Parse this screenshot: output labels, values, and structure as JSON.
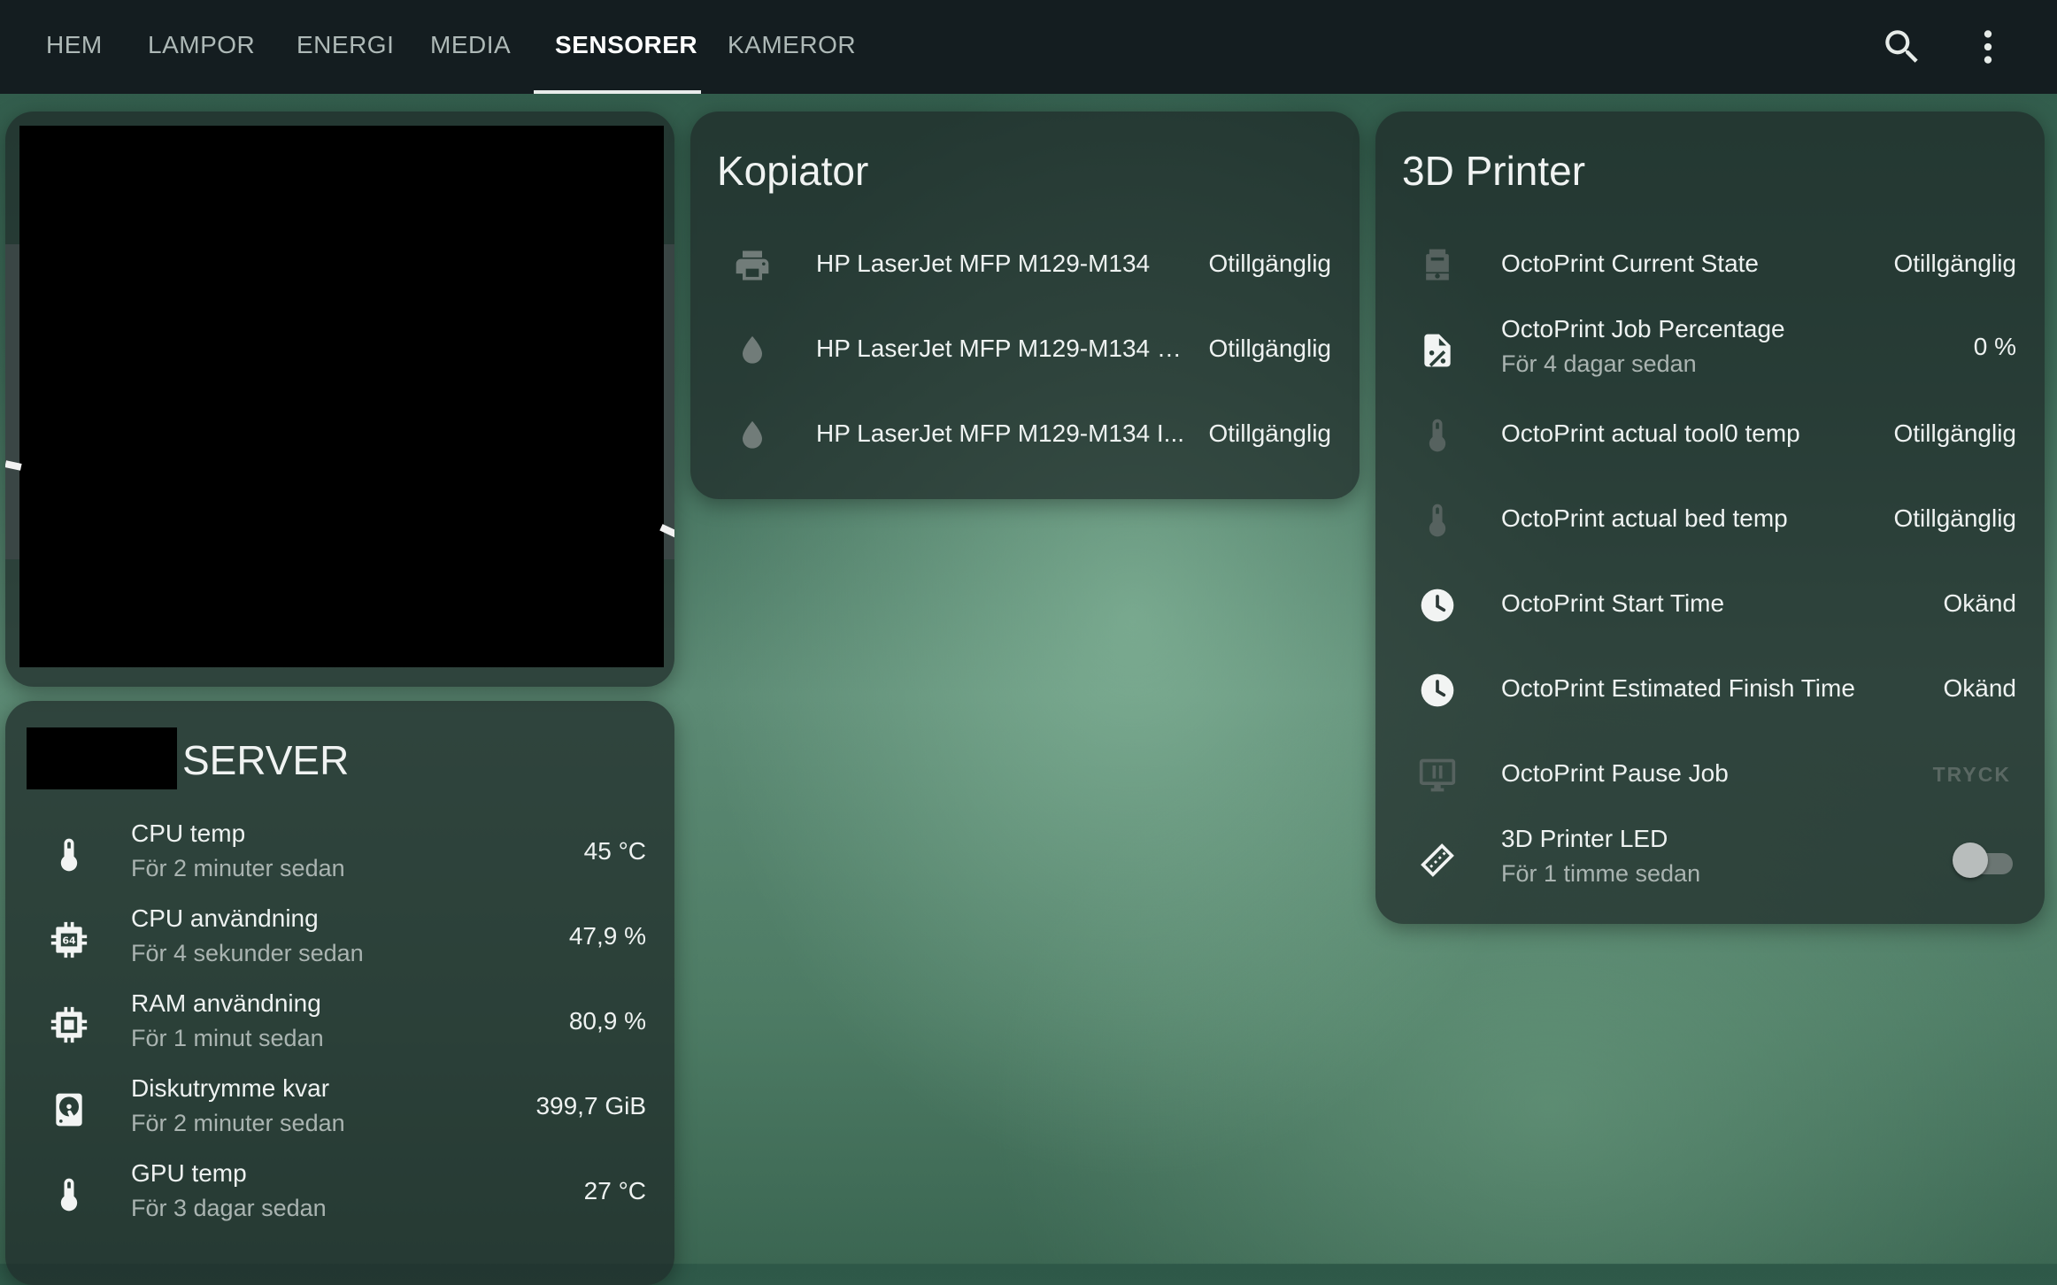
{
  "nav": {
    "tabs": [
      {
        "label": "HEM"
      },
      {
        "label": "LAMPOR"
      },
      {
        "label": "ENERGI"
      },
      {
        "label": "MEDIA"
      },
      {
        "label": "SENSORER"
      },
      {
        "label": "KAMEROR"
      }
    ],
    "active_tab": "SENSORER",
    "icons": [
      "search-icon",
      "more-vertical-icon"
    ]
  },
  "server_card": {
    "title": "SERVER",
    "rows": [
      {
        "name": "CPU temp",
        "sub": "För 2 minuter sedan",
        "value": "45 °C",
        "icon": "thermometer-icon"
      },
      {
        "name": "CPU användning",
        "sub": "För 4 sekunder sedan",
        "value": "47,9 %",
        "icon": "cpu-64-icon"
      },
      {
        "name": "RAM användning",
        "sub": "För 1 minut sedan",
        "value": "80,9 %",
        "icon": "memory-chip-icon"
      },
      {
        "name": "Diskutrymme kvar",
        "sub": "För 2 minuter sedan",
        "value": "399,7 GiB",
        "icon": "harddisk-icon"
      },
      {
        "name": "GPU temp",
        "sub": "För 3 dagar sedan",
        "value": "27 °C",
        "icon": "thermometer-icon"
      }
    ]
  },
  "copier_card": {
    "title": "Kopiator",
    "rows": [
      {
        "name": "HP LaserJet MFP M129-M134",
        "value": "Otillgänglig",
        "icon": "printer-icon"
      },
      {
        "name": "HP LaserJet MFP M129-M134 Bl...",
        "value": "Otillgänglig",
        "icon": "water-drop-icon"
      },
      {
        "name": "HP LaserJet MFP M129-M134 I...",
        "value": "Otillgänglig",
        "icon": "water-drop-icon"
      }
    ]
  },
  "printer_card": {
    "title": "3D Printer",
    "rows": [
      {
        "name": "OctoPrint Current State",
        "sub": "",
        "value": "Otillgänglig",
        "icon": "printer-3d-icon"
      },
      {
        "name": "OctoPrint Job Percentage",
        "sub": "För 4 dagar sedan",
        "value": "0 %",
        "icon": "file-percent-icon"
      },
      {
        "name": "OctoPrint actual tool0 temp",
        "sub": "",
        "value": "Otillgänglig",
        "icon": "thermometer-icon"
      },
      {
        "name": "OctoPrint actual bed temp",
        "sub": "",
        "value": "Otillgänglig",
        "icon": "thermometer-icon"
      },
      {
        "name": "OctoPrint Start Time",
        "sub": "",
        "value": "Okänd",
        "icon": "clock-icon"
      },
      {
        "name": "OctoPrint Estimated Finish Time",
        "sub": "",
        "value": "Okänd",
        "icon": "clock-icon"
      },
      {
        "name": "OctoPrint Pause Job",
        "sub": "",
        "value": "TRYCK",
        "icon": "monitor-pause-icon"
      },
      {
        "name": "3D Printer LED",
        "sub": "För 1 timme sedan",
        "value": "off",
        "icon": "led-strip-icon"
      }
    ]
  }
}
